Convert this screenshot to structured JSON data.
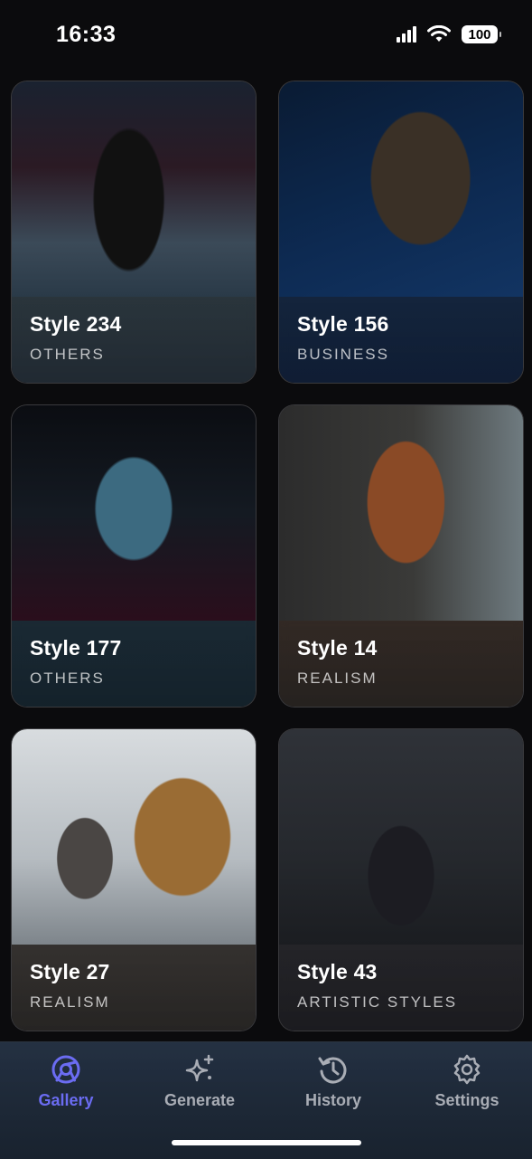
{
  "status_bar": {
    "time": "16:33",
    "battery": "100"
  },
  "gallery": {
    "cards": [
      {
        "title": "Style 234",
        "category": "OTHERS"
      },
      {
        "title": "Style 156",
        "category": "BUSINESS"
      },
      {
        "title": "Style 177",
        "category": "OTHERS"
      },
      {
        "title": "Style 14",
        "category": "REALISM"
      },
      {
        "title": "Style 27",
        "category": "REALISM"
      },
      {
        "title": "Style 43",
        "category": "ARTISTIC STYLES"
      }
    ]
  },
  "tab_bar": {
    "tabs": [
      {
        "label": "Gallery",
        "icon": "gallery-icon",
        "active": true
      },
      {
        "label": "Generate",
        "icon": "sparkles-icon",
        "active": false
      },
      {
        "label": "History",
        "icon": "history-icon",
        "active": false
      },
      {
        "label": "Settings",
        "icon": "gear-icon",
        "active": false
      }
    ]
  },
  "colors": {
    "accent": "#6b6cf2",
    "background": "#0b0b0d"
  }
}
